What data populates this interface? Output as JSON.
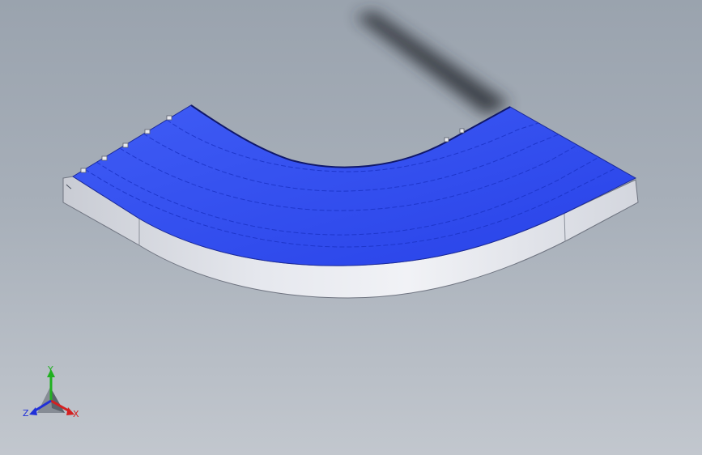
{
  "viewport": {
    "background_top": "#9aa3ae",
    "background_bottom": "#c2c7ce"
  },
  "model": {
    "belt_color": "#2f4cf0",
    "frame_color": "#d6d9e0",
    "shadow_color": "#2a2e35"
  },
  "triad": {
    "x_label": "X",
    "y_label": "Y",
    "z_label": "Z",
    "x_color": "#d42020",
    "y_color": "#20b020",
    "z_color": "#2030d8"
  }
}
